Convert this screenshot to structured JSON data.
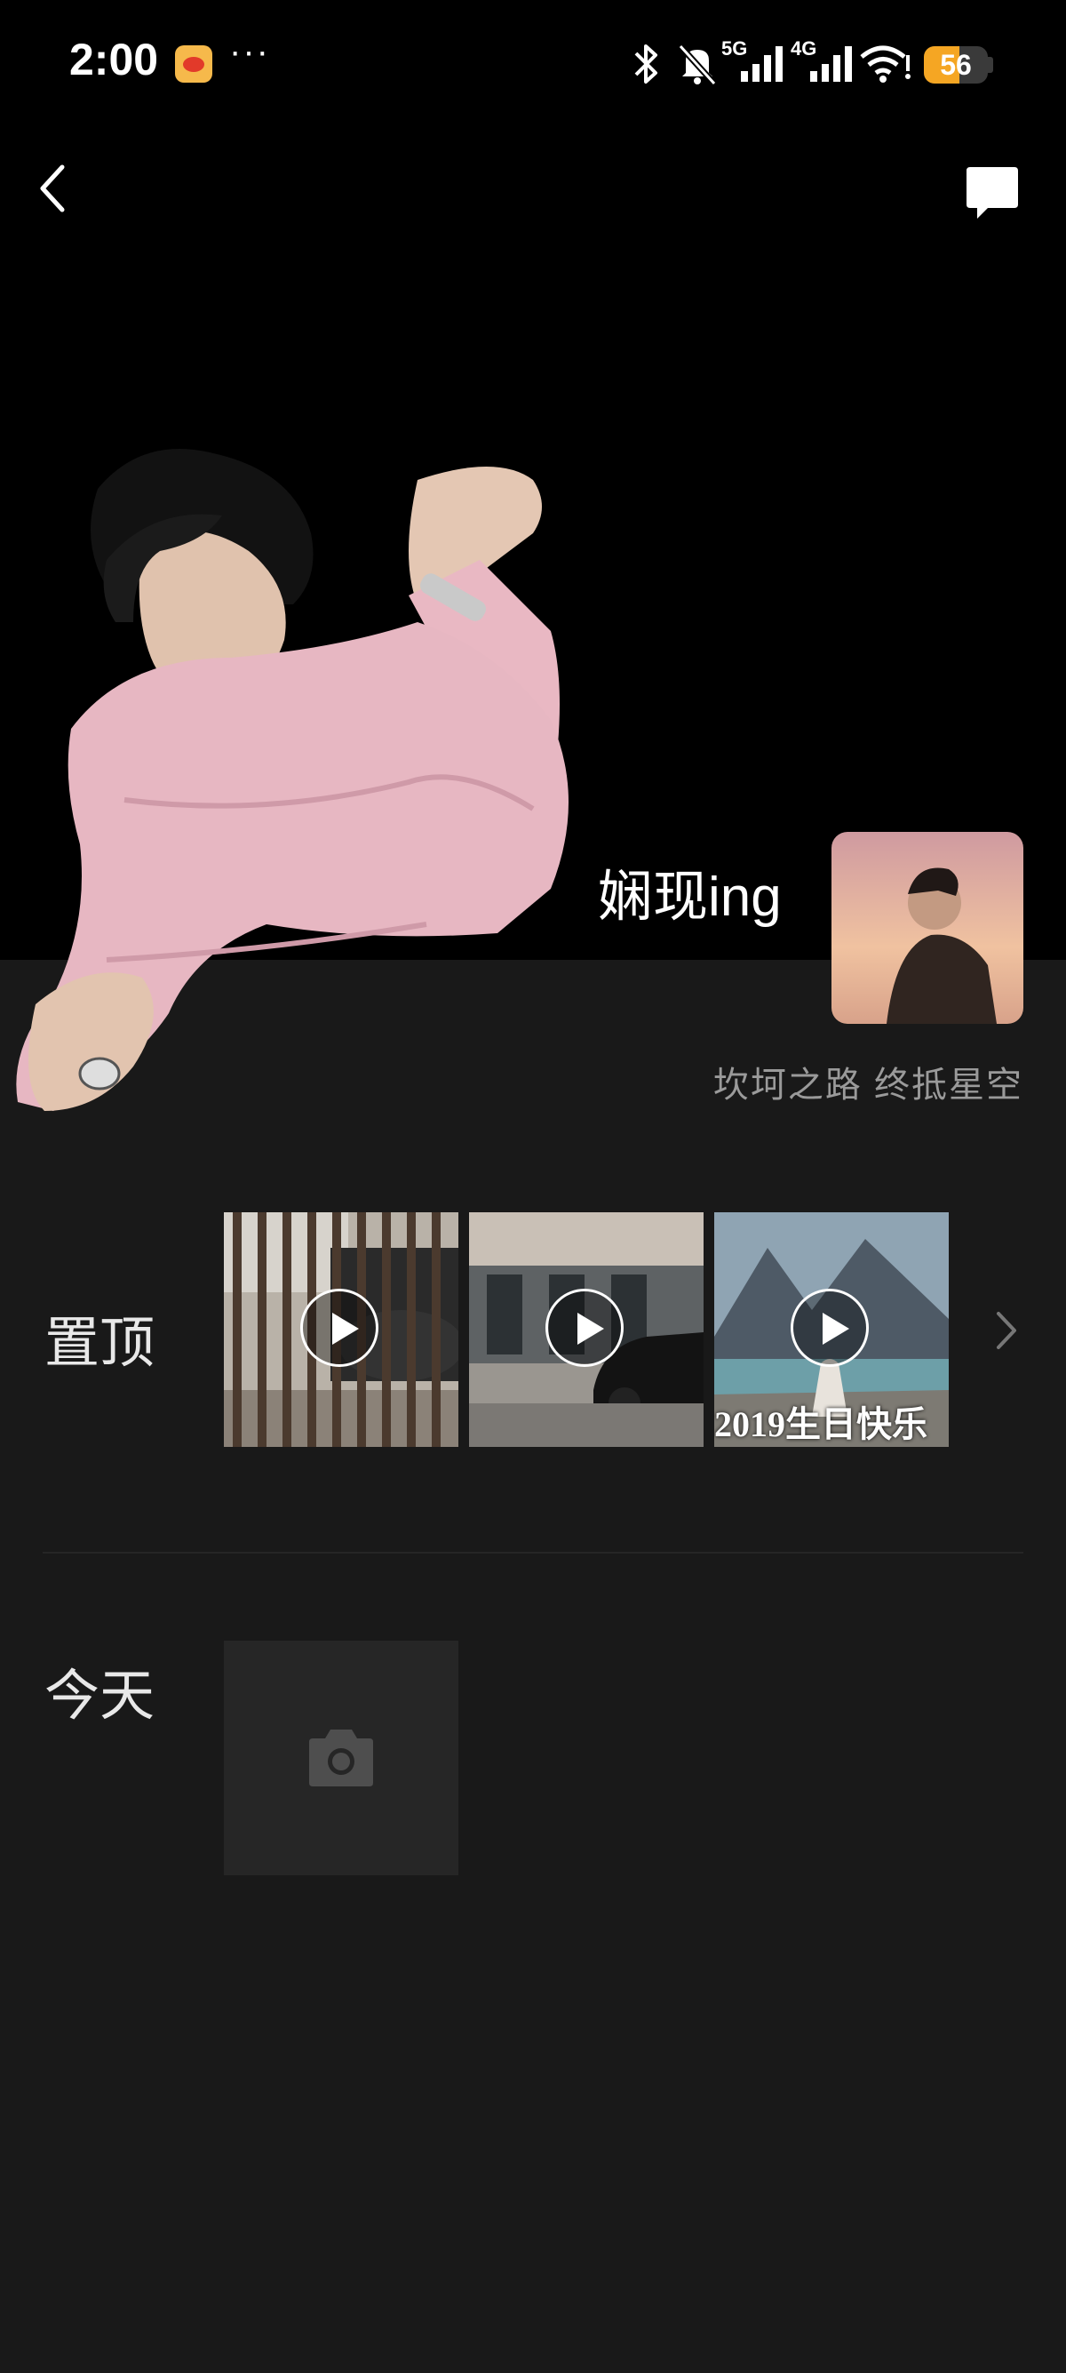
{
  "status_bar": {
    "time": "2:00",
    "more": "···",
    "battery": "56",
    "battery_level": 0.56,
    "network_5g": "5G",
    "network_4g": "4G"
  },
  "profile": {
    "username": "娴现ing",
    "signature": "坎坷之路  终抵星空"
  },
  "pinned": {
    "label": "置顶",
    "items": [
      {
        "caption": ""
      },
      {
        "caption": ""
      },
      {
        "caption": "2019生日快乐"
      }
    ]
  },
  "today": {
    "label": "今天"
  },
  "colors": {
    "background": "#191919",
    "header": "#000000",
    "battery": "#f5a623"
  }
}
